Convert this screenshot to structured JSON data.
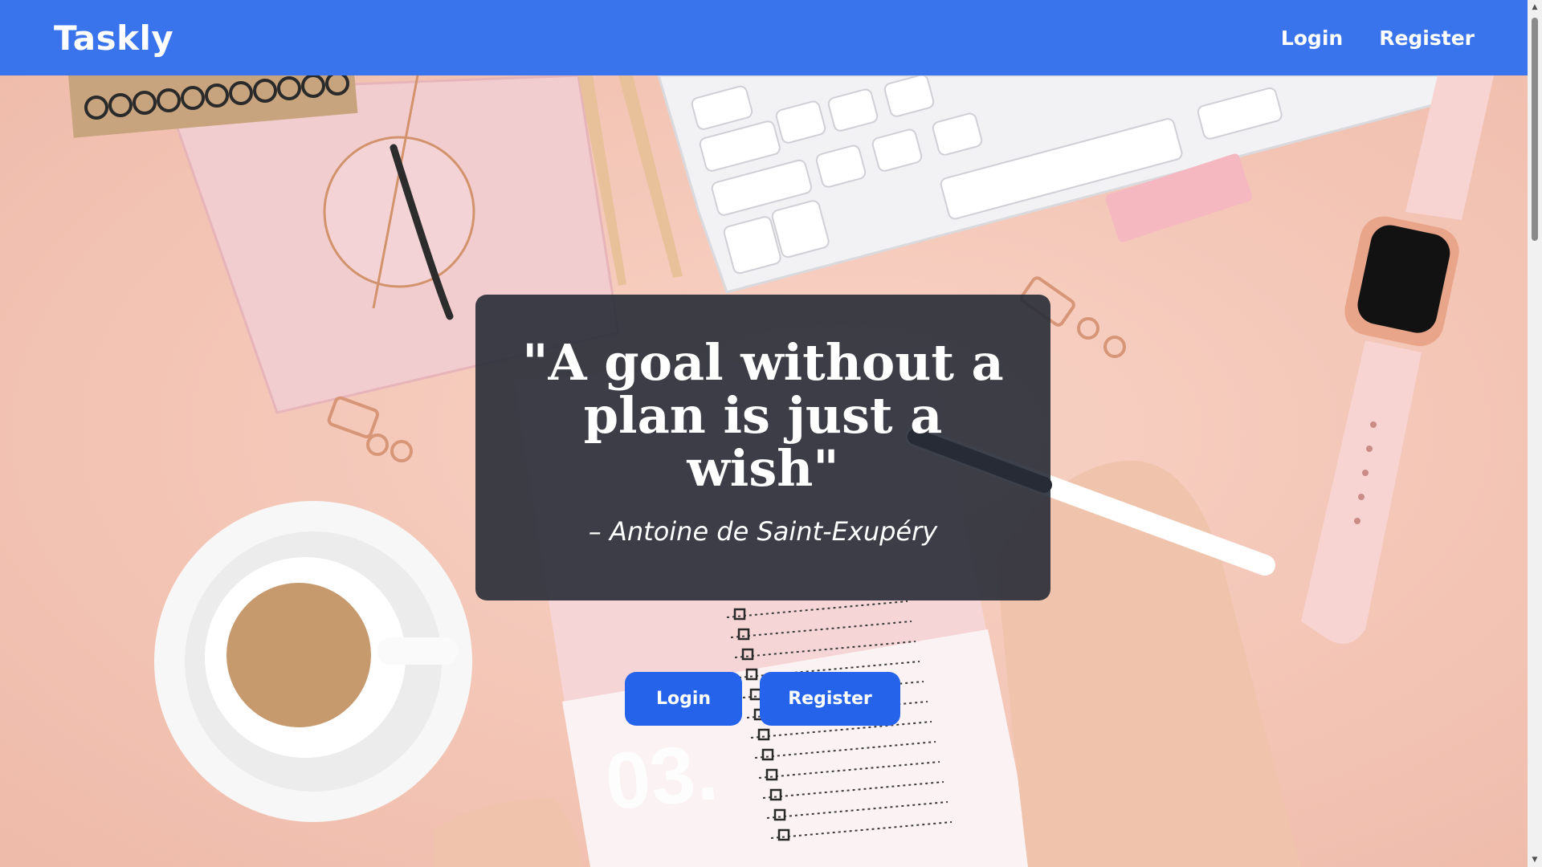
{
  "navbar": {
    "brand": "Taskly",
    "links": [
      {
        "label": "Login"
      },
      {
        "label": "Register"
      }
    ]
  },
  "hero": {
    "quote": "\"A goal without a plan is just a wish\"",
    "author": "– Antoine de Saint-Exupéry",
    "buttons": {
      "login": "Login",
      "register": "Register"
    },
    "background_note_number": "03."
  },
  "colors": {
    "nav_bg": "#3a74ec",
    "button_bg": "#2563eb",
    "card_bg": "#282c37",
    "background": "#f4c9bb"
  },
  "icons": [
    "scroll-up-arrow-icon",
    "scroll-down-arrow-icon"
  ]
}
